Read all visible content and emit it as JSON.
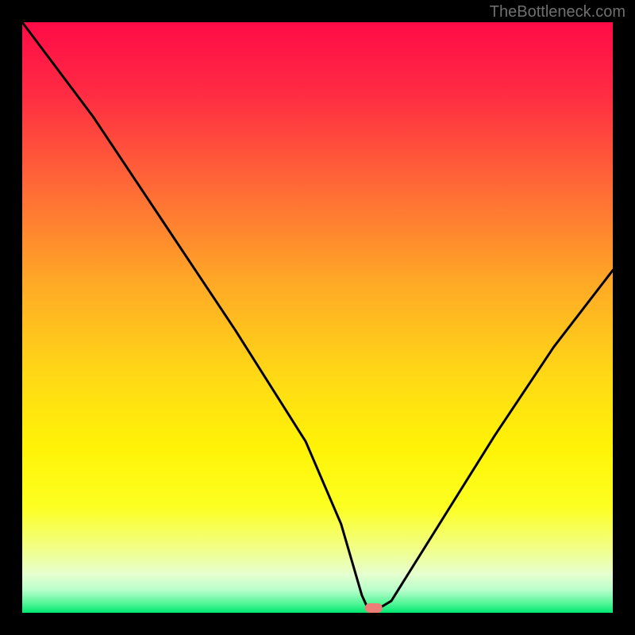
{
  "attribution": "TheBottleneck.com",
  "chart_data": {
    "type": "line",
    "title": "",
    "xlabel": "",
    "ylabel": "",
    "xlim": [
      0,
      100
    ],
    "ylim": [
      0,
      100
    ],
    "series": [
      {
        "name": "bottleneck-curve",
        "x": [
          0,
          12,
          24,
          36,
          48,
          54,
          57.5,
          58.5,
          60.5,
          62.5,
          70,
          80,
          90,
          100
        ],
        "values": [
          100,
          84,
          66,
          48,
          29,
          15,
          3,
          0.8,
          0.8,
          2,
          14,
          30,
          45,
          58
        ]
      }
    ],
    "marker": {
      "x": 59.5,
      "y": 0.8,
      "color": "#eb7f78"
    },
    "gradient_stops": [
      {
        "offset": 0.0,
        "color": "#ff0b47"
      },
      {
        "offset": 0.12,
        "color": "#ff2b43"
      },
      {
        "offset": 0.28,
        "color": "#ff6a36"
      },
      {
        "offset": 0.45,
        "color": "#ffac25"
      },
      {
        "offset": 0.6,
        "color": "#ffd915"
      },
      {
        "offset": 0.72,
        "color": "#fff307"
      },
      {
        "offset": 0.82,
        "color": "#fcff20"
      },
      {
        "offset": 0.89,
        "color": "#f2ff86"
      },
      {
        "offset": 0.935,
        "color": "#e6ffd0"
      },
      {
        "offset": 0.962,
        "color": "#b7feca"
      },
      {
        "offset": 0.985,
        "color": "#4ef595"
      },
      {
        "offset": 1.0,
        "color": "#00e772"
      }
    ]
  }
}
